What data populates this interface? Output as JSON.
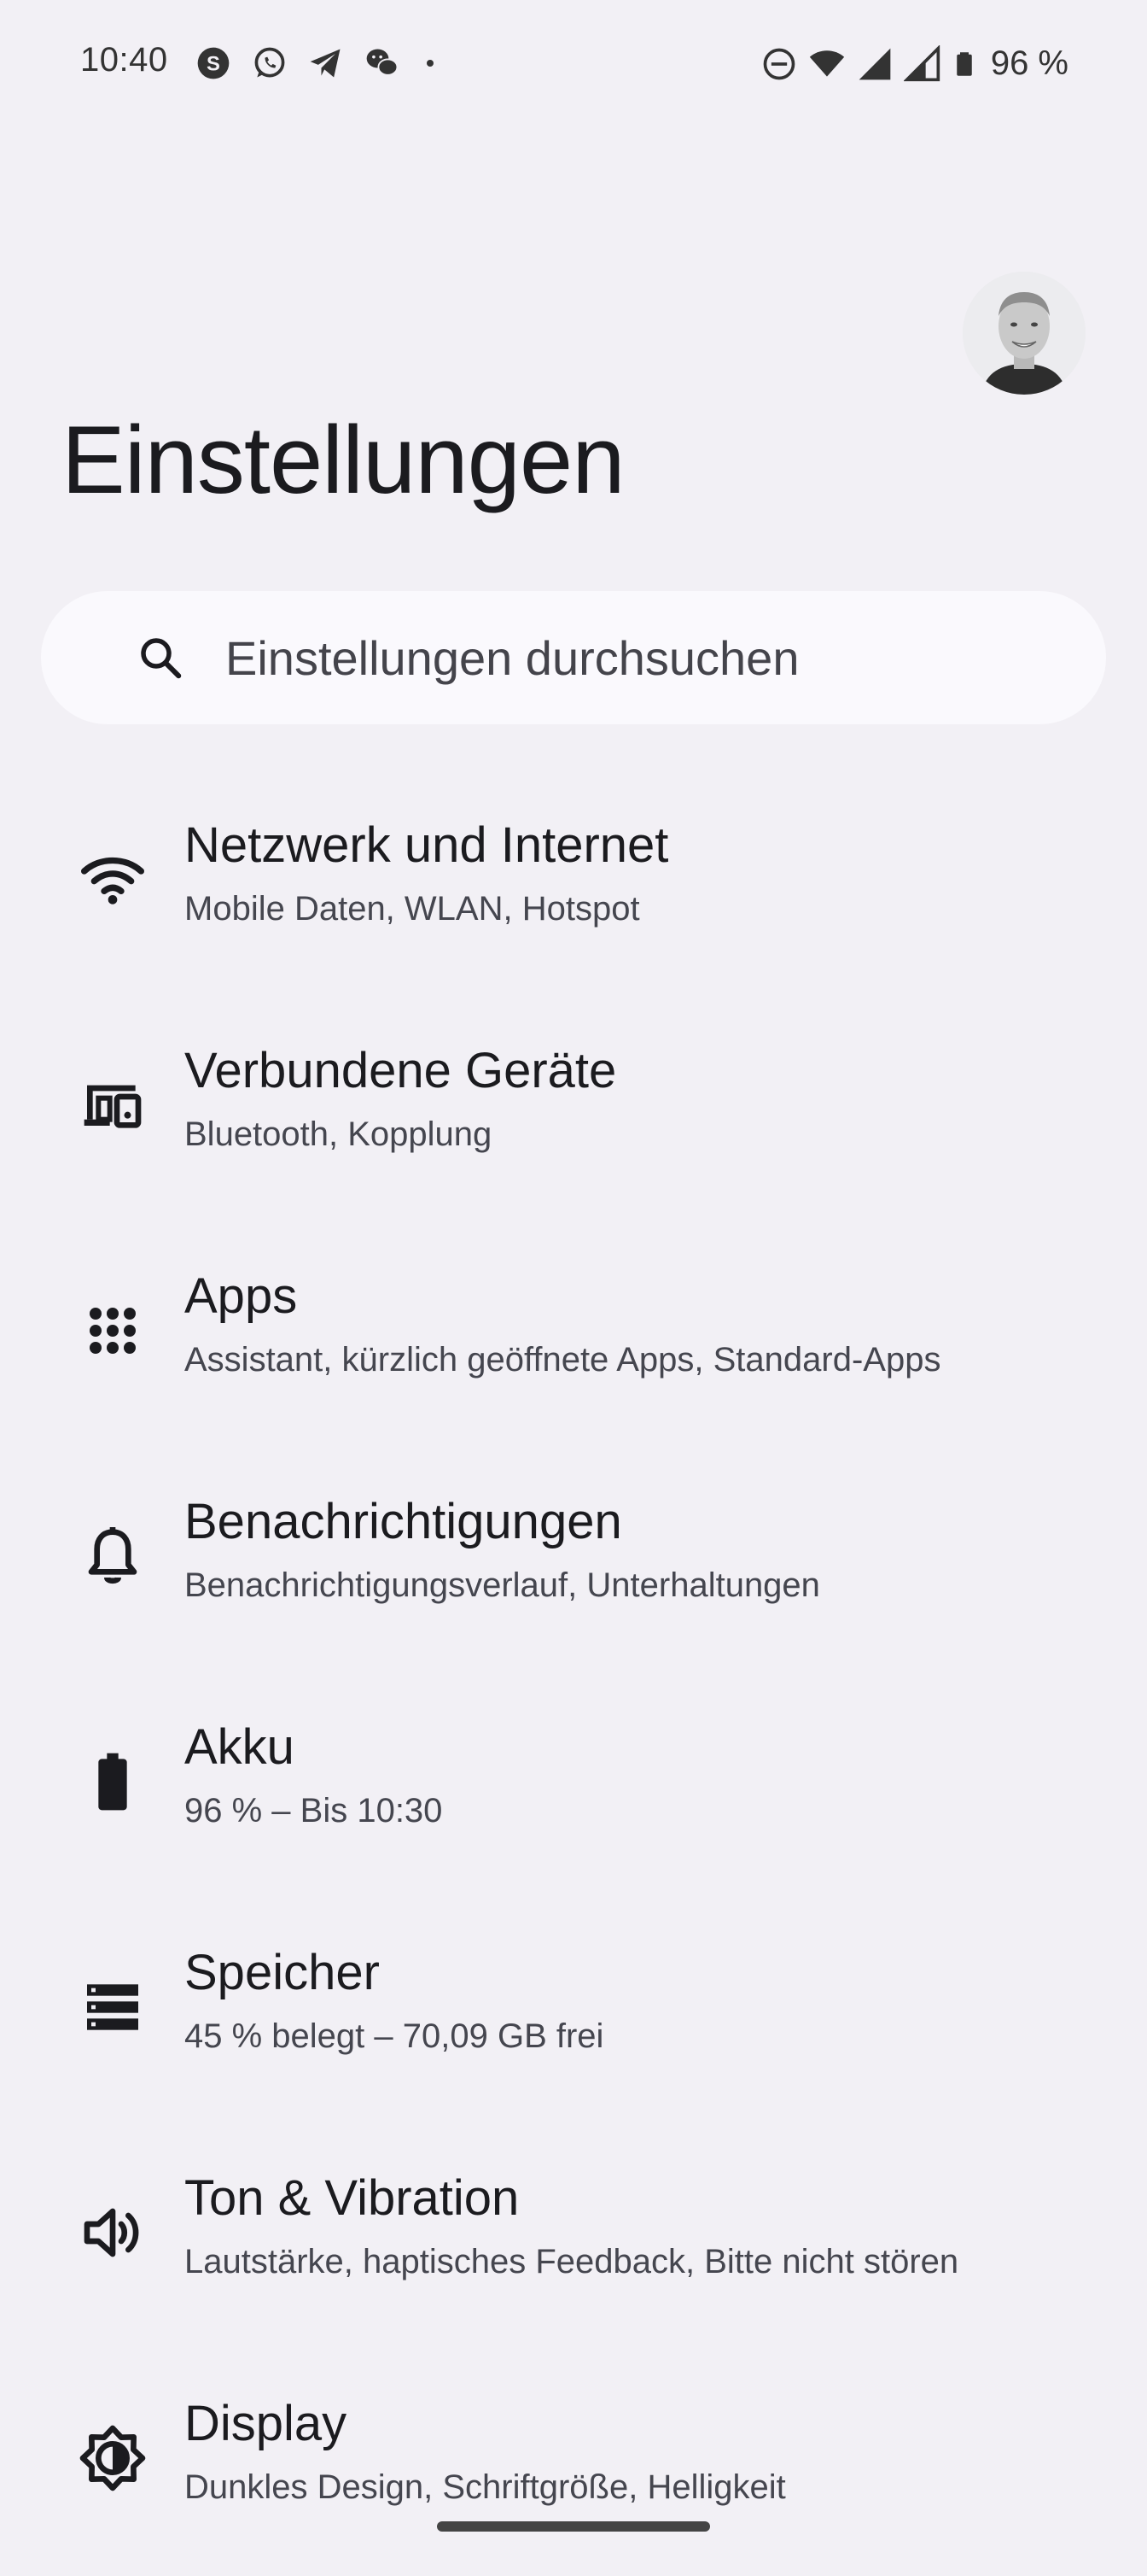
{
  "status_bar": {
    "time": "10:40",
    "battery_text": "96 %",
    "left_icons": [
      "skype-icon",
      "whatsapp-icon",
      "telegram-icon",
      "wechat-icon",
      "dot-icon"
    ],
    "right_icons": [
      "do-not-disturb-icon",
      "wifi-icon",
      "signal-icon",
      "signal-icon",
      "battery-icon"
    ]
  },
  "page": {
    "title": "Einstellungen"
  },
  "search": {
    "placeholder": "Einstellungen durchsuchen"
  },
  "settings": [
    {
      "icon": "wifi-icon",
      "title": "Netzwerk und Internet",
      "subtitle": "Mobile Daten, WLAN, Hotspot"
    },
    {
      "icon": "devices-icon",
      "title": "Verbundene Geräte",
      "subtitle": "Bluetooth, Kopplung"
    },
    {
      "icon": "apps-grid-icon",
      "title": "Apps",
      "subtitle": "Assistant, kürzlich geöffnete Apps, Standard-Apps"
    },
    {
      "icon": "bell-icon",
      "title": "Benachrichtigungen",
      "subtitle": "Benachrichtigungsverlauf, Unterhaltungen"
    },
    {
      "icon": "battery-icon",
      "title": "Akku",
      "subtitle": "96 % – Bis 10:30"
    },
    {
      "icon": "storage-icon",
      "title": "Speicher",
      "subtitle": "45 % belegt – 70,09 GB frei"
    },
    {
      "icon": "volume-icon",
      "title": "Ton & Vibration",
      "subtitle": "Lautstärke, haptisches Feedback, Bitte nicht stören"
    },
    {
      "icon": "brightness-icon",
      "title": "Display",
      "subtitle": "Dunkles Design, Schriftgröße, Helligkeit"
    }
  ],
  "colors": {
    "background": "#f2f0f5",
    "search_background": "#faf9fd",
    "text_primary": "#1b1b1f",
    "text_secondary": "#45464f"
  }
}
